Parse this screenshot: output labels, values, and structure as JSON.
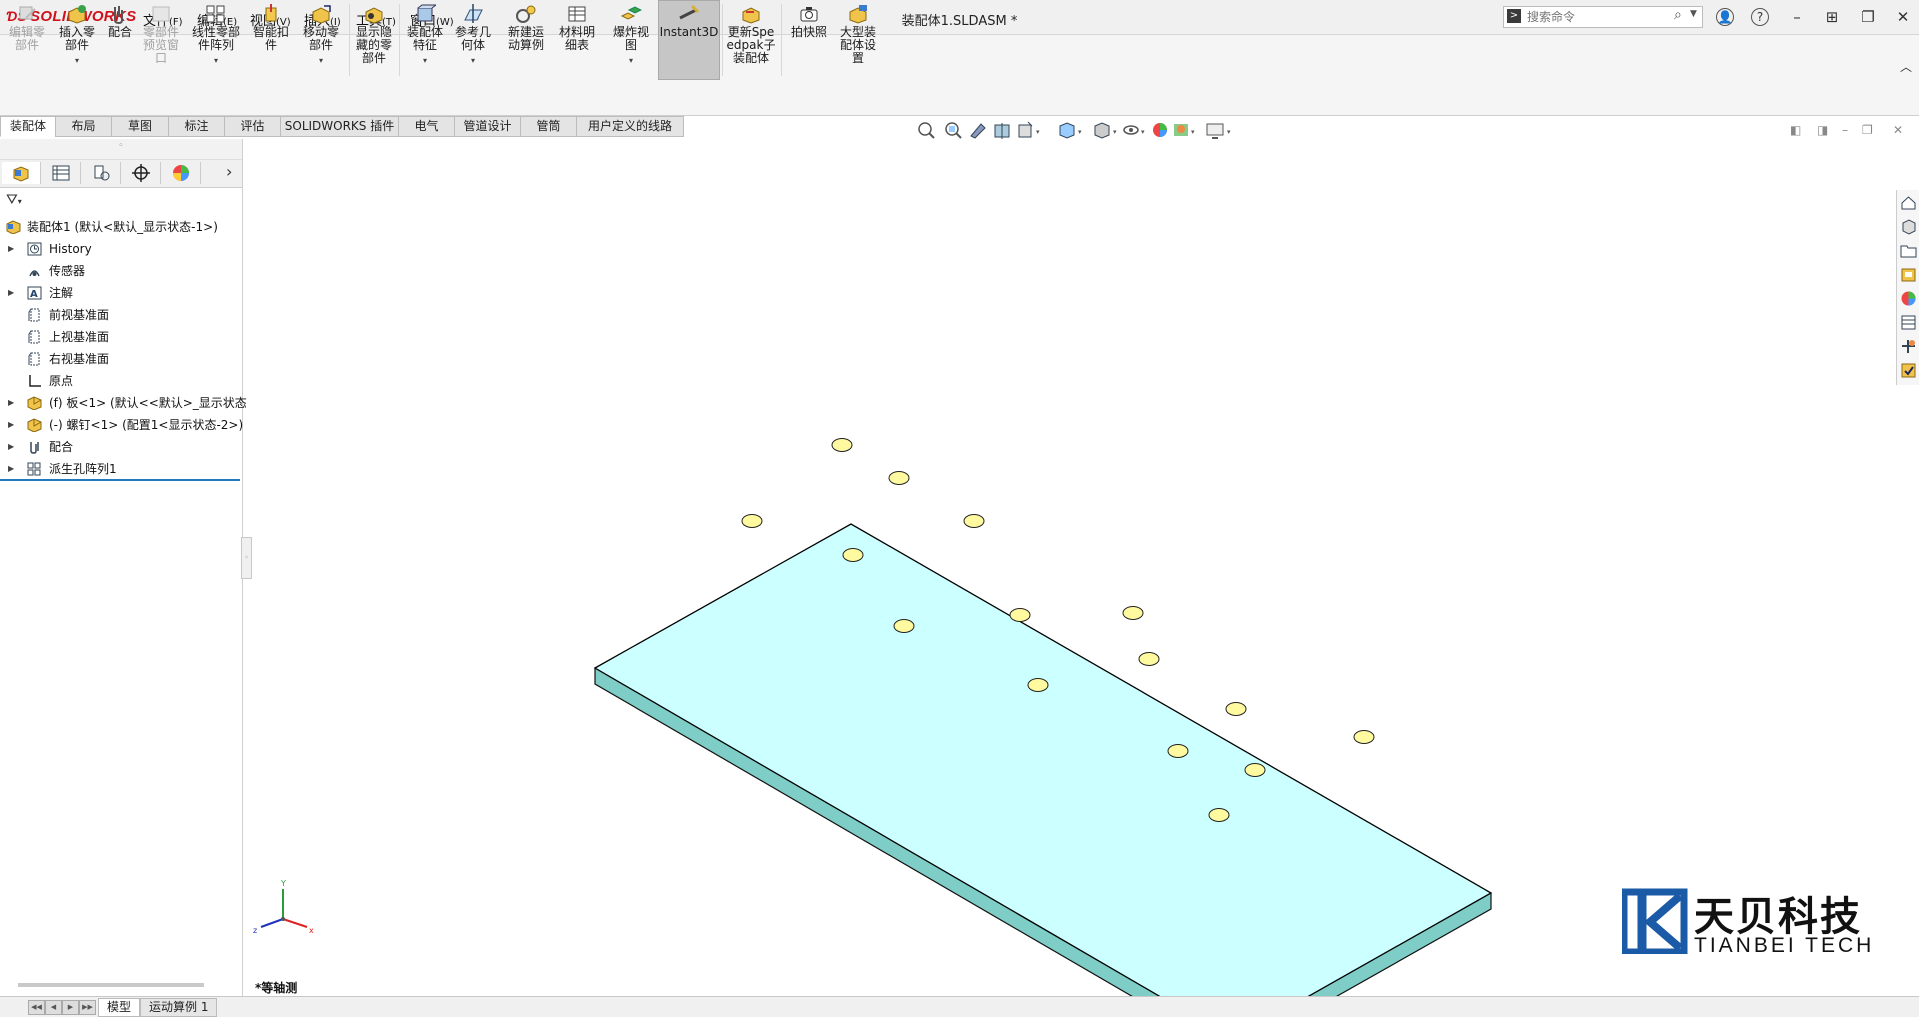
{
  "app": {
    "logo": "SOLIDWORKS",
    "document_title": "装配体1.SLDASM *"
  },
  "menu": [
    {
      "label": "文件",
      "key": "(F)"
    },
    {
      "label": "编辑",
      "key": "(E)"
    },
    {
      "label": "视图",
      "key": "(V)"
    },
    {
      "label": "插入",
      "key": "(I)"
    },
    {
      "label": "工具",
      "key": "(T)"
    },
    {
      "label": "窗口",
      "key": "(W)"
    }
  ],
  "search": {
    "placeholder": "搜索命令"
  },
  "ribbon": [
    {
      "label": "编辑零部件",
      "icon": "edit-component-icon",
      "disabled": true
    },
    {
      "label": "插入零部件",
      "icon": "insert-component-icon"
    },
    {
      "label": "配合",
      "icon": "mate-icon"
    },
    {
      "label": "零部件预览窗口",
      "icon": "component-preview-icon",
      "disabled": true
    },
    {
      "label": "线性零部件阵列",
      "icon": "linear-pattern-icon"
    },
    {
      "label": "智能扣件",
      "icon": "smart-fasteners-icon"
    },
    {
      "label": "移动零部件",
      "icon": "move-component-icon"
    },
    {
      "label": "显示隐藏的零部件",
      "icon": "show-hidden-icon"
    },
    {
      "label": "装配体特征",
      "icon": "assembly-features-icon"
    },
    {
      "label": "参考几何体",
      "icon": "reference-geometry-icon"
    },
    {
      "label": "新建运动算例",
      "icon": "new-motion-study-icon"
    },
    {
      "label": "材料明细表",
      "icon": "bom-icon"
    },
    {
      "label": "爆炸视图",
      "icon": "exploded-view-icon"
    },
    {
      "label": "Instant3D",
      "icon": "instant3d-icon",
      "active": true
    },
    {
      "label": "更新Speedpak子装配体",
      "icon": "speedpak-icon"
    },
    {
      "label": "拍快照",
      "icon": "snapshot-icon"
    },
    {
      "label": "大型装配体设置",
      "icon": "large-assembly-icon"
    }
  ],
  "tabs": [
    "装配体",
    "布局",
    "草图",
    "标注",
    "评估",
    "SOLIDWORKS 插件",
    "电气",
    "管道设计",
    "管筒",
    "用户定义的线路"
  ],
  "tree": {
    "root": "装配体1  (默认<默认_显示状态-1>)",
    "items": [
      {
        "label": "History",
        "icon": "history-icon",
        "expandable": true
      },
      {
        "label": "传感器",
        "icon": "sensor-icon",
        "expandable": false
      },
      {
        "label": "注解",
        "icon": "annotation-icon",
        "expandable": true
      },
      {
        "label": "前视基准面",
        "icon": "plane-icon",
        "expandable": false
      },
      {
        "label": "上视基准面",
        "icon": "plane-icon",
        "expandable": false
      },
      {
        "label": "右视基准面",
        "icon": "plane-icon",
        "expandable": false
      },
      {
        "label": "原点",
        "icon": "origin-icon",
        "expandable": false
      },
      {
        "label": "(f) 板<1> (默认<<默认>_显示状态",
        "icon": "part-icon",
        "expandable": true
      },
      {
        "label": "(-) 螺钉<1> (配置1<显示状态-2>)",
        "icon": "part-icon",
        "expandable": true
      },
      {
        "label": "配合",
        "icon": "mates-icon",
        "expandable": true
      },
      {
        "label": "派生孔阵列1",
        "icon": "pattern-icon",
        "expandable": true
      }
    ]
  },
  "viewport": {
    "view_label": "*等轴测",
    "triad": {
      "x": "x",
      "y": "Y",
      "z": "z"
    },
    "plate_top_color": "#ccffff",
    "plate_side_color": "#7fcdc7",
    "screw_color": "#fffaa0"
  },
  "brand": {
    "cn": "天贝科技",
    "en": "TIANBEI TECH",
    "color": "#1a5aa6"
  },
  "bottom_tabs": [
    "模型",
    "运动算例 1"
  ]
}
